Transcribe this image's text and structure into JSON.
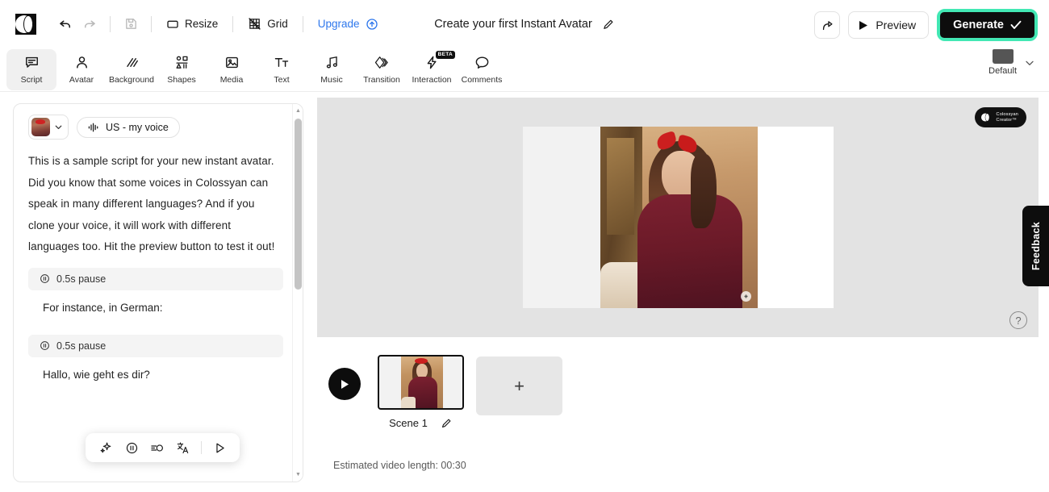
{
  "topbar": {
    "logo_icon": "colossyan-logo-icon",
    "undo": {
      "label": "Undo",
      "icon": "undo-icon"
    },
    "redo": {
      "label": "Redo",
      "icon": "redo-icon"
    },
    "save": {
      "label": "Save",
      "icon": "save-disk-icon"
    },
    "resize": {
      "label": "Resize",
      "icon": "rectangle-icon"
    },
    "grid": {
      "label": "Grid",
      "icon": "grid-off-icon"
    },
    "upgrade": {
      "label": "Upgrade",
      "icon": "upgrade-arrow-icon"
    },
    "doc_title": "Create your first Instant Avatar",
    "title_edit_icon": "pencil-icon",
    "share": {
      "label": "Share",
      "icon": "share-arrow-icon"
    },
    "preview": {
      "label": "Preview",
      "icon": "play-icon"
    },
    "generate": {
      "label": "Generate",
      "icon": "check-icon"
    },
    "generate_highlight_color": "#42e8b4",
    "generate_bg_color": "#0d0d0d"
  },
  "tooltabs": {
    "items": [
      {
        "label": "Script",
        "icon": "script-icon",
        "active": true
      },
      {
        "label": "Avatar",
        "icon": "person-icon",
        "active": false
      },
      {
        "label": "Background",
        "icon": "diagonal-lines-icon",
        "active": false
      },
      {
        "label": "Shapes",
        "icon": "shapes-icon",
        "active": false
      },
      {
        "label": "Media",
        "icon": "image-icon",
        "active": false
      },
      {
        "label": "Text",
        "icon": "text-type-icon",
        "active": false
      },
      {
        "label": "Music",
        "icon": "music-note-icon",
        "active": false
      },
      {
        "label": "Transition",
        "icon": "transition-diamond-icon",
        "active": false
      },
      {
        "label": "Interaction",
        "icon": "lightning-bolt-icon",
        "active": false,
        "badge": "BETA"
      },
      {
        "label": "Comments",
        "icon": "speech-bubble-icon",
        "active": false
      }
    ],
    "default_selector": {
      "label": "Default",
      "icon": "folder-icon",
      "chevron": "chevron-down-icon"
    }
  },
  "script": {
    "avatar_chip": {
      "icon": "avatar-thumbnail",
      "chevron": "chevron-down-icon"
    },
    "voice_chip": {
      "label": "US - my voice",
      "icon": "waveform-icon"
    },
    "paragraph": "This is a sample script for your new instant avatar. Did you know that some voices in Colossyan can speak in many different languages? And if you clone your voice, it will work with different languages too. Hit the preview button to test it out!",
    "pause_1": {
      "label": "0.5s pause",
      "icon": "pause-circle-icon"
    },
    "line_1": "For instance, in German:",
    "pause_2": {
      "label": "0.5s pause",
      "icon": "pause-circle-icon"
    },
    "line_2": "Hallo, wie geht es dir?",
    "float_tools": [
      {
        "name": "ai-sparkle",
        "icon": "sparkles-icon"
      },
      {
        "name": "pause",
        "icon": "pause-circle-icon"
      },
      {
        "name": "speed",
        "icon": "speed-icon"
      },
      {
        "name": "translate",
        "icon": "translate-icon"
      },
      {
        "name": "play",
        "icon": "play-outline-icon"
      }
    ]
  },
  "canvas": {
    "watermark_line1": "Colossyan",
    "watermark_line2": "Creator™",
    "help_icon": "question-mark-icon"
  },
  "scenes": {
    "play_icon": "play-icon",
    "items": [
      {
        "label": "Scene 1",
        "edit_icon": "pencil-icon",
        "selected": true
      }
    ],
    "add_label": "+",
    "estimated_length": "Estimated video length: 00:30"
  },
  "feedback": {
    "label": "Feedback"
  }
}
